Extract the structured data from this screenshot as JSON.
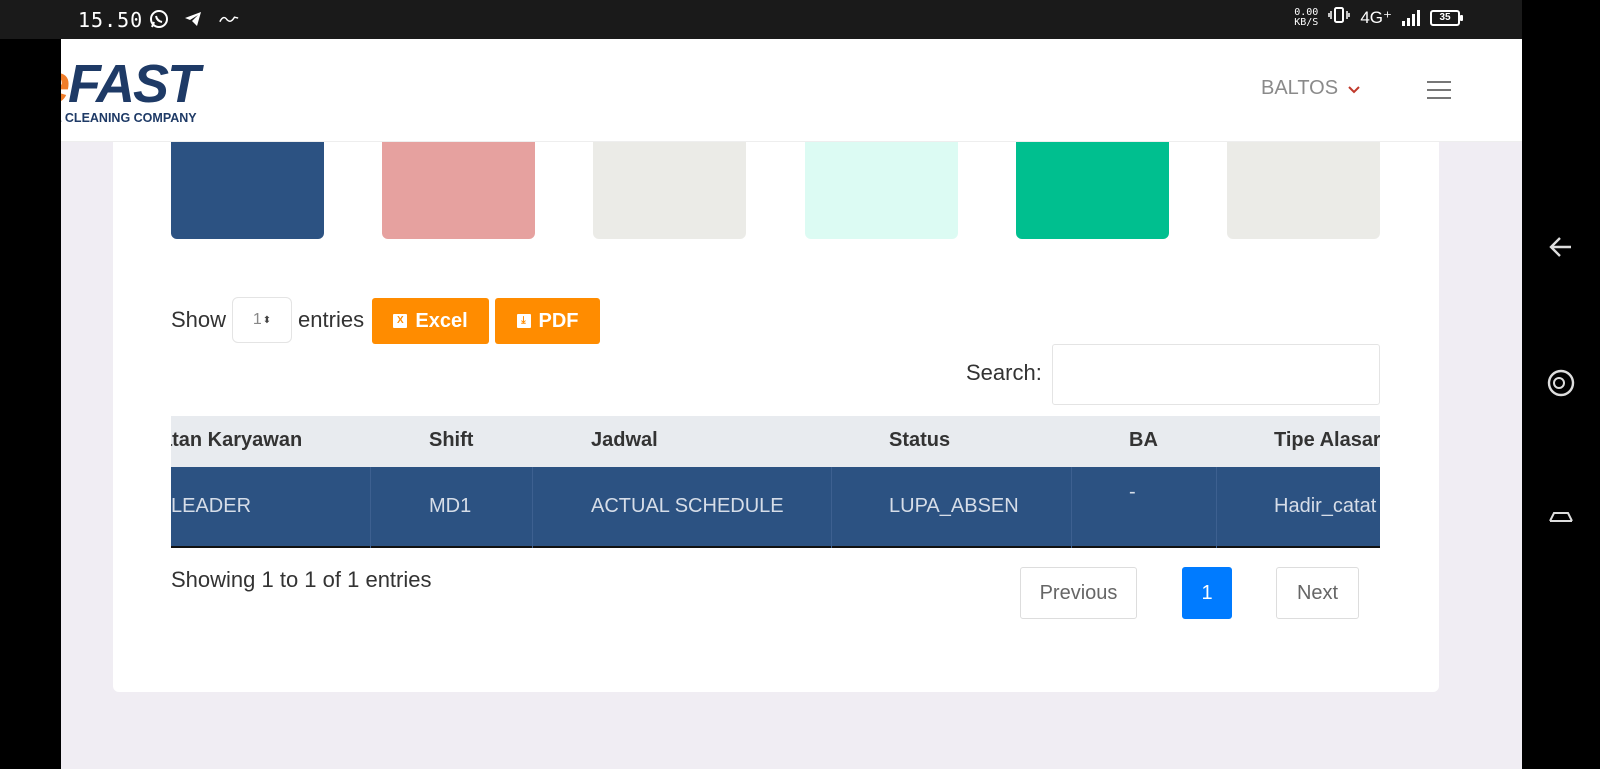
{
  "status_bar": {
    "time": "15.50",
    "icons": [
      "whatsapp-icon",
      "telegram-icon",
      "app-notification-icon"
    ],
    "net_speed_top": "0.00",
    "net_speed_bottom": "KB/S",
    "network": "4G⁺",
    "battery": "35"
  },
  "header": {
    "logo_word_left": "re",
    "logo_word_right": "FAST",
    "logo_tagline": "AL CLEANING COMPANY",
    "user": "BALTOS",
    "colors": {
      "orange": "#f07d2a",
      "navy": "#1e3a66"
    }
  },
  "swatches": [
    "#2c5282",
    "#e6a19f",
    "#ebebe7",
    "#dcfbf3",
    "#00bf8f",
    "#ebebe7"
  ],
  "controls": {
    "show_label": "Show",
    "show_value": "1",
    "entries_label": "entries",
    "excel_label": "Excel",
    "pdf_label": "PDF",
    "search_label": "Search:",
    "search_value": ""
  },
  "table": {
    "headers": [
      "atan Karyawan",
      "Shift",
      "Jadwal",
      "Status",
      "BA",
      "Tipe Alasar"
    ],
    "rows": [
      [
        "LEADER",
        "MD1",
        "ACTUAL SCHEDULE",
        "LUPA_ABSEN",
        "-",
        "Hadir_catat"
      ]
    ]
  },
  "footer": {
    "info": "Showing 1 to 1 of 1 entries",
    "prev": "Previous",
    "page": "1",
    "next": "Next"
  }
}
